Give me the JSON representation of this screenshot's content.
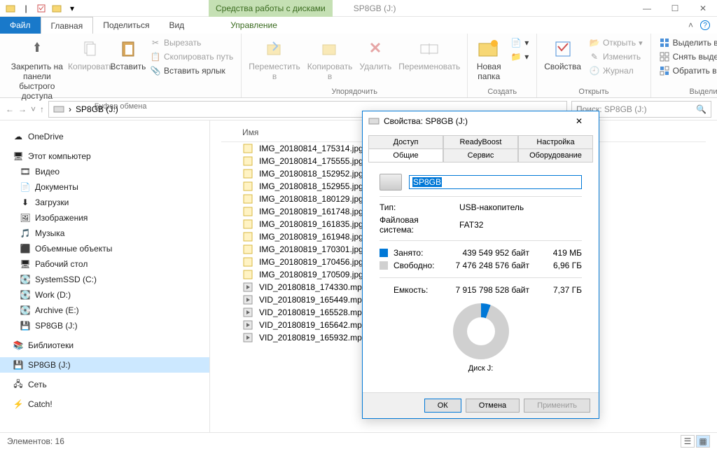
{
  "titlebar": {
    "contextual_tab": "Средства работы с дисками",
    "window_title": "SP8GB (J:)"
  },
  "tabs": {
    "file": "Файл",
    "home": "Главная",
    "share": "Поделиться",
    "view": "Вид",
    "manage": "Управление"
  },
  "ribbon": {
    "clipboard": {
      "pin": "Закрепить на панели\nбыстрого доступа",
      "copy": "Копировать",
      "paste": "Вставить",
      "cut": "Вырезать",
      "copy_path": "Скопировать путь",
      "paste_shortcut": "Вставить ярлык",
      "group": "Буфер обмена"
    },
    "organize": {
      "moveto": "Переместить\nв",
      "copyto": "Копировать\nв",
      "delete": "Удалить",
      "rename": "Переименовать",
      "group": "Упорядочить"
    },
    "new": {
      "new_folder": "Новая\nпапка",
      "group": "Создать"
    },
    "open": {
      "properties": "Свойства",
      "open": "Открыть",
      "edit": "Изменить",
      "history": "Журнал",
      "group": "Открыть"
    },
    "select": {
      "select_all": "Выделить все",
      "select_none": "Снять выделение",
      "invert": "Обратить выделение",
      "group": "Выделить"
    }
  },
  "breadcrumb": {
    "location": "SP8GB (J:)",
    "search_placeholder": "Поиск: SP8GB (J:)"
  },
  "sidebar": {
    "onedrive": "OneDrive",
    "this_pc": "Этот компьютер",
    "videos": "Видео",
    "documents": "Документы",
    "downloads": "Загрузки",
    "pictures": "Изображения",
    "music": "Музыка",
    "objects3d": "Объемные объекты",
    "desktop": "Рабочий стол",
    "systemssd": "SystemSSD (C:)",
    "work": "Work (D:)",
    "archive": "Archive (E:)",
    "sp8gb": "SP8GB (J:)",
    "libraries": "Библиотеки",
    "sp8gb2": "SP8GB (J:)",
    "network": "Сеть",
    "catch": "Catch!"
  },
  "filelist": {
    "col_name": "Имя",
    "files": [
      "IMG_20180814_175314.jpg",
      "IMG_20180814_175555.jpg",
      "IMG_20180818_152952.jpg",
      "IMG_20180818_152955.jpg",
      "IMG_20180818_180129.jpg",
      "IMG_20180819_161748.jpg",
      "IMG_20180819_161835.jpg",
      "IMG_20180819_161948.jpg",
      "IMG_20180819_170301.jpg",
      "IMG_20180819_170456.jpg",
      "IMG_20180819_170509.jpg",
      "VID_20180818_174330.mp4",
      "VID_20180819_165449.mp4",
      "VID_20180819_165528.mp4",
      "VID_20180819_165642.mp4",
      "VID_20180819_165932.mp4"
    ]
  },
  "statusbar": {
    "elements": "Элементов: 16"
  },
  "properties": {
    "title": "Свойства: SP8GB (J:)",
    "tabs": {
      "access": "Доступ",
      "readyboost": "ReadyBoost",
      "settings": "Настройка",
      "general": "Общие",
      "service": "Сервис",
      "hardware": "Оборудование"
    },
    "volume_label": "SP8GB",
    "type_label": "Тип:",
    "type_value": "USB-накопитель",
    "fs_label": "Файловая система:",
    "fs_value": "FAT32",
    "used_label": "Занято:",
    "used_bytes": "439 549 952 байт",
    "used_human": "419 МБ",
    "free_label": "Свободно:",
    "free_bytes": "7 476 248 576 байт",
    "free_human": "6,96 ГБ",
    "capacity_label": "Емкость:",
    "capacity_bytes": "7 915 798 528 байт",
    "capacity_human": "7,37 ГБ",
    "disk_label": "Диск J:",
    "ok": "ОК",
    "cancel": "Отмена",
    "apply": "Применить"
  }
}
